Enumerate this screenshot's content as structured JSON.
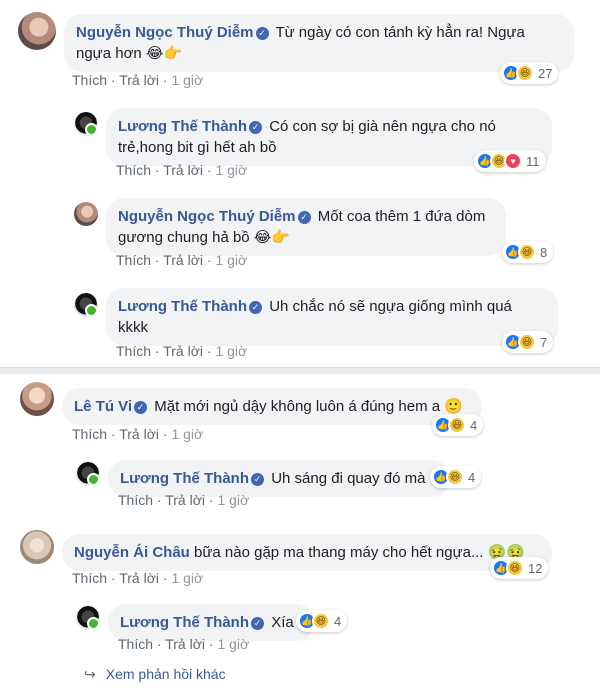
{
  "verified_mark": "✓",
  "reply_arrow": "↪",
  "reactions": {
    "like_glyph": "👍",
    "haha_glyph": "😆",
    "love_glyph": "♥"
  },
  "comments": [
    {
      "author": "Nguyễn Ngọc Thuý Diễm",
      "text": "Từ ngày có con tánh kỳ hẳn ra! Ngựa ngựa hơn",
      "text_line1": "Từ ngày có con tánh kỳ hẳn ra! Ngựa",
      "text_line2": "ngựa hơn",
      "emoji": "😂👉",
      "like": "Thích",
      "reply": "Trả lời",
      "time": "1 giờ",
      "reaction_count": "27",
      "avatar": "avatar-diem"
    },
    {
      "author": "Lương Thế Thành",
      "text_line1": "Có con sợ bị già nên ngựa cho nó",
      "text_line2": "trẻ,hong bit gì hết ah bồ",
      "like": "Thích",
      "reply": "Trả lời",
      "time": "1 giờ",
      "reaction_count": "11",
      "avatar": "avatar-thanh"
    },
    {
      "author": "Nguyễn Ngọc Thuý Diễm",
      "text_line1": "Mốt coa thêm 1 đứa dòm",
      "text_line2": "gương chung hả bồ",
      "emoji": "😂👉",
      "like": "Thích",
      "reply": "Trả lời",
      "time": "1 giờ",
      "reaction_count": "8",
      "avatar": "avatar-diem"
    },
    {
      "author": "Lương Thế Thành",
      "text_line1": "Uh chắc nó sẽ ngựa giống mình quá",
      "text_line2": "kkkk",
      "like": "Thích",
      "reply": "Trả lời",
      "time": "1 giờ",
      "reaction_count": "7",
      "avatar": "avatar-thanh"
    },
    {
      "author": "Lê Tú Vi",
      "text": "Mặt mới ngủ dậy không luôn á đúng hem a",
      "emoji": "🙂",
      "like": "Thích",
      "reply": "Trả lời",
      "time": "1 giờ",
      "reaction_count": "4",
      "avatar": "avatar-vi"
    },
    {
      "author": "Lương Thế Thành",
      "text": "Uh sáng đi quay đó mà",
      "like": "Thích",
      "reply": "Trả lời",
      "time": "1 giờ",
      "reaction_count": "4",
      "avatar": "avatar-thanh"
    },
    {
      "author": "Nguyễn Ái Châu",
      "text": "bữa nào gặp ma thang máy cho hết ngựa...",
      "emoji": "🤢🤢",
      "like": "Thích",
      "reply": "Trả lời",
      "time": "1 giờ",
      "reaction_count": "12",
      "avatar": "avatar-chau"
    },
    {
      "author": "Lương Thế Thành",
      "text": "Xía",
      "like": "Thích",
      "reply": "Trả lời",
      "time": "1 giờ",
      "reaction_count": "4",
      "avatar": "avatar-thanh"
    }
  ],
  "more_replies": "Xem phản hồi khác"
}
